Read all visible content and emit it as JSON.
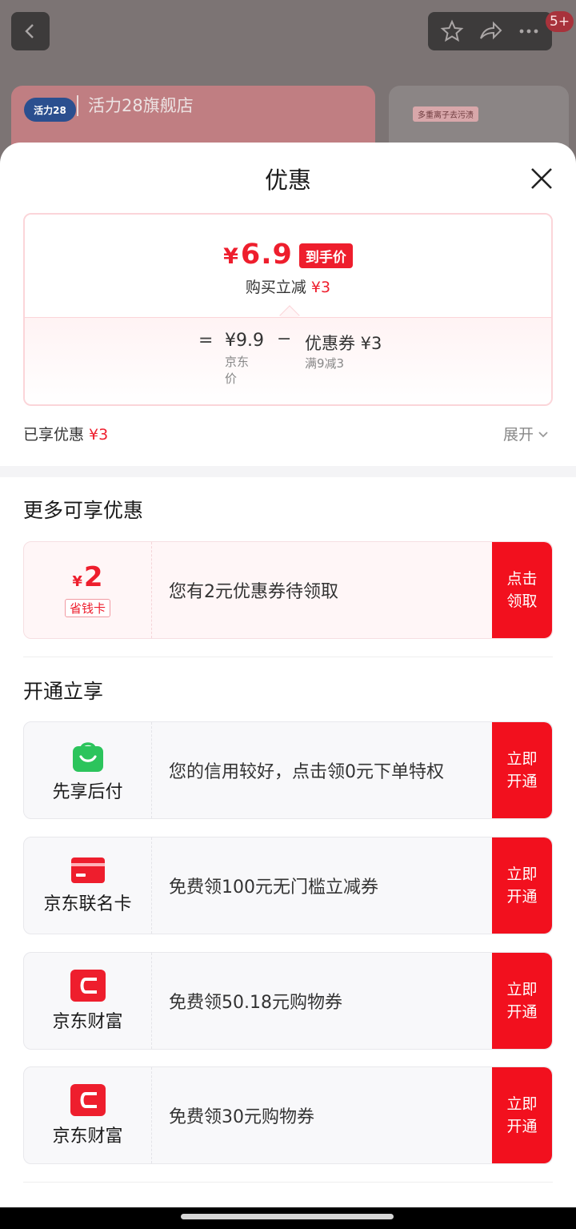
{
  "background": {
    "store_logo": "活力28",
    "store_name": "活力28旗舰店",
    "badge": "5+",
    "promo_tag": "多重离子去污渍"
  },
  "sheet": {
    "title": "优惠"
  },
  "price_summary": {
    "final_price": "6.9",
    "currency": "¥",
    "final_tag": "到手价",
    "instant_cut_label": "购买立减",
    "instant_cut_value": "¥3",
    "equals": "=",
    "jd_price": "¥9.9",
    "jd_price_label": "京东价",
    "minus": "−",
    "coupon_label": "优惠券 ¥3",
    "coupon_condition": "满9减3"
  },
  "enjoyed": {
    "label": "已享优惠",
    "value": "¥3",
    "expand_label": "展开"
  },
  "more_section": {
    "title": "更多可享优惠",
    "offers": [
      {
        "amount": "2",
        "currency": "¥",
        "tag": "省钱卡",
        "text": "您有2元优惠券待领取",
        "button_label": "点击领取"
      }
    ]
  },
  "open_section": {
    "title": "开通立享",
    "offers": [
      {
        "icon": "shopping-bag-icon",
        "icon_color": "#2cc45c",
        "label": "先享后付",
        "text": "您的信用较好，点击领0元下单特权",
        "button_label": "立即开通"
      },
      {
        "icon": "bank-card-icon",
        "icon_color": "#ee1e2d",
        "label": "京东联名卡",
        "text": "免费领100元无门槛立减券",
        "button_label": "立即开通"
      },
      {
        "icon": "jd-finance-icon",
        "icon_color": "#ee1e2d",
        "label": "京东财富",
        "text": "免费领50.18元购物券",
        "button_label": "立即开通"
      },
      {
        "icon": "jd-finance-icon",
        "icon_color": "#ee1e2d",
        "label": "京东财富",
        "text": "免费领30元购物券",
        "button_label": "立即开通"
      }
    ]
  },
  "colors": {
    "accent": "#ee1e2d",
    "button": "#f2101e",
    "green": "#2cc45c"
  }
}
